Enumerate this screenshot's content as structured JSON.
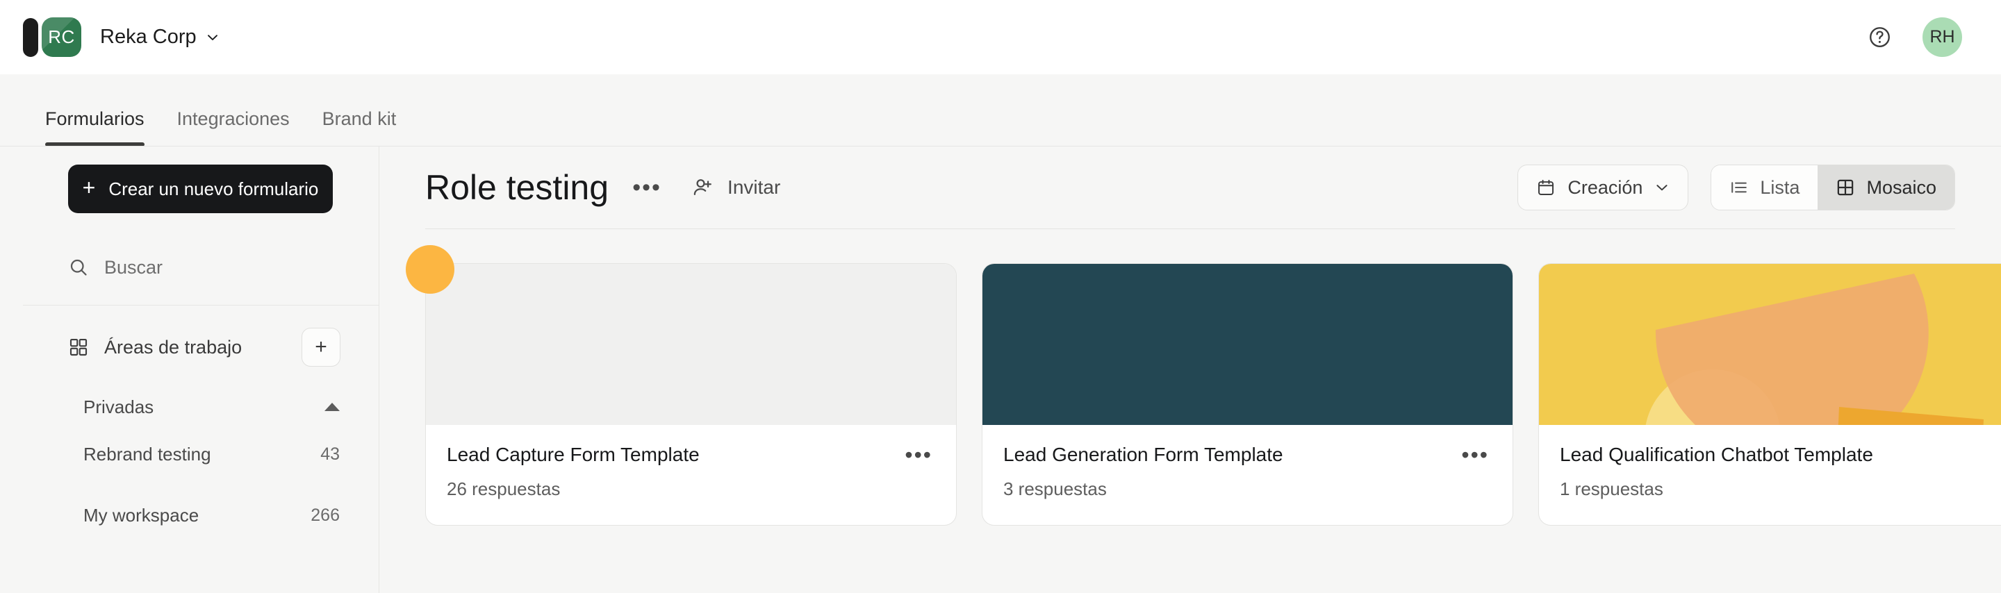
{
  "topbar": {
    "workspace_initials": "RC",
    "workspace_name": "Reka Corp",
    "caret_icon": "chevron-down-icon",
    "help_icon": "help-circle-icon",
    "user_initials": "RH"
  },
  "tabs": [
    {
      "label": "Formularios",
      "active": true
    },
    {
      "label": "Integraciones",
      "active": false
    },
    {
      "label": "Brand kit",
      "active": false
    }
  ],
  "sidebar": {
    "create_button": {
      "label": "Crear un nuevo formulario",
      "icon": "plus-icon"
    },
    "search": {
      "placeholder": "Buscar",
      "icon": "search-icon"
    },
    "areas": {
      "label": "Áreas de trabajo",
      "icon": "grid-icon",
      "add_label": "+",
      "add_icon": "plus-icon"
    },
    "privadas": {
      "label": "Privadas",
      "caret_icon": "chevron-up-icon"
    },
    "workspaces": [
      {
        "name": "Rebrand testing",
        "count": "43"
      },
      {
        "name": "My workspace",
        "count": "266"
      }
    ]
  },
  "main": {
    "title": "Role testing",
    "title_menu_icon": "ellipsis-icon",
    "title_menu_label": "•••",
    "invite": {
      "label": "Invitar",
      "icon": "user-plus-icon"
    },
    "sort": {
      "label": "Creación",
      "icon": "calendar-icon",
      "caret_icon": "chevron-down-icon"
    },
    "view_toggle": [
      {
        "label": "Lista",
        "icon": "list-icon",
        "active": false
      },
      {
        "label": "Mosaico",
        "icon": "grid-tile-icon",
        "active": true
      }
    ],
    "cards": [
      {
        "title": "Lead Capture Form Template",
        "responses": "26 respuestas",
        "menu_label": "•••",
        "thumb_style": "plain",
        "thumb_bg": "#f0f0ef"
      },
      {
        "title": "Lead Generation Form Template",
        "responses": "3 respuestas",
        "menu_label": "•••",
        "thumb_style": "solid",
        "thumb_bg": "#234753"
      },
      {
        "title": "Lead Qualification Chatbot Template",
        "responses": "1 respuestas",
        "menu_label": "•••",
        "thumb_style": "abstract",
        "thumb_bg": "#f2cb4e"
      }
    ],
    "drag_marker_color": "#fcb642"
  },
  "colors": {
    "brand_green": "#2f7a4f",
    "avatar_green": "#aadcb4",
    "accent_dark": "#17181a",
    "page_bg": "#f6f6f5",
    "card_teal": "#234753",
    "card_yellow": "#f2cb4e",
    "marker_orange": "#fcb642"
  }
}
